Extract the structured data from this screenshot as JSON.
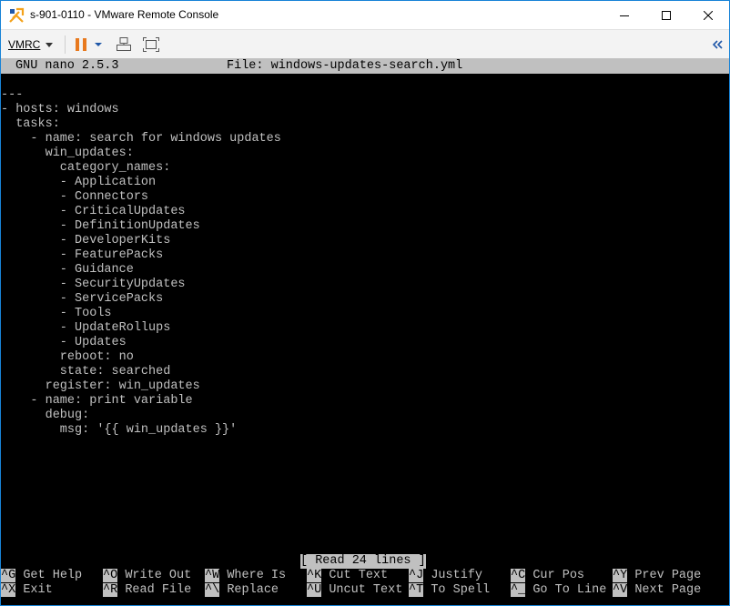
{
  "window": {
    "title": "s-901-0110 - VMware Remote Console",
    "controls": [
      "minimize",
      "maximize",
      "close"
    ]
  },
  "toolbar": {
    "menu_label": "VMRC",
    "icons": [
      "pause-icon",
      "dropdown-arrow-icon",
      "send-keys-icon",
      "fit-window-icon",
      "collapse-icon"
    ],
    "colors": {
      "pause": "#e8791e",
      "accent": "#1f57a8"
    }
  },
  "nano": {
    "version": "GNU nano 2.5.3",
    "file_label": "File: windows-updates-search.yml",
    "status": "[ Read 24 lines ]",
    "lines": [
      "",
      "---",
      "- hosts: windows",
      "  tasks:",
      "    - name: search for windows updates",
      "      win_updates:",
      "        category_names:",
      "        - Application",
      "        - Connectors",
      "        - CriticalUpdates",
      "        - DefinitionUpdates",
      "        - DeveloperKits",
      "        - FeaturePacks",
      "        - Guidance",
      "        - SecurityUpdates",
      "        - ServicePacks",
      "        - Tools",
      "        - UpdateRollups",
      "        - Updates",
      "        reboot: no",
      "        state: searched",
      "      register: win_updates",
      "    - name: print variable",
      "      debug:",
      "        msg: '{{ win_updates }}'"
    ],
    "shortcuts_row1": [
      {
        "key": "^G",
        "label": "Get Help"
      },
      {
        "key": "^O",
        "label": "Write Out"
      },
      {
        "key": "^W",
        "label": "Where Is"
      },
      {
        "key": "^K",
        "label": "Cut Text"
      },
      {
        "key": "^J",
        "label": "Justify"
      },
      {
        "key": "^C",
        "label": "Cur Pos"
      },
      {
        "key": "^Y",
        "label": "Prev Page"
      }
    ],
    "shortcuts_row2": [
      {
        "key": "^X",
        "label": "Exit"
      },
      {
        "key": "^R",
        "label": "Read File"
      },
      {
        "key": "^\\",
        "label": "Replace"
      },
      {
        "key": "^U",
        "label": "Uncut Text"
      },
      {
        "key": "^T",
        "label": "To Spell"
      },
      {
        "key": "^_",
        "label": "Go To Line"
      },
      {
        "key": "^V",
        "label": "Next Page"
      }
    ]
  }
}
